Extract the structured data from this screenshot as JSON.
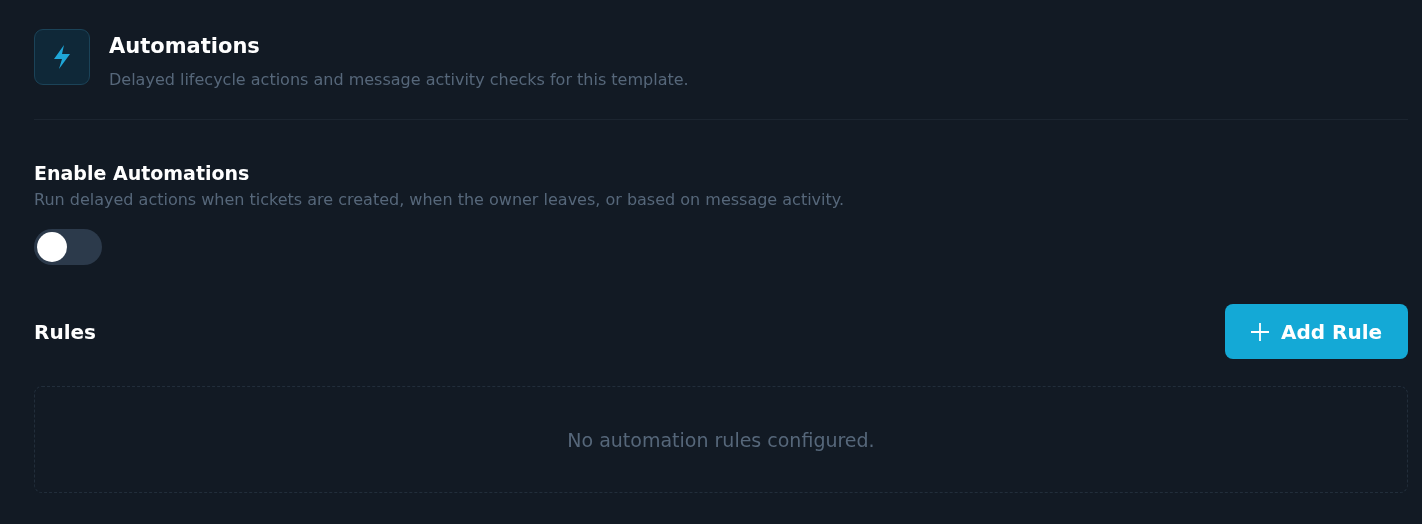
{
  "header": {
    "title": "Automations",
    "subtitle": "Delayed lifecycle actions and message activity checks for this template."
  },
  "enable": {
    "label": "Enable Automations",
    "description": "Run delayed actions when tickets are created, when the owner leaves, or based on message activity.",
    "on": false
  },
  "rules": {
    "title": "Rules",
    "add_button": "Add Rule",
    "empty_text": "No automation rules configured."
  }
}
